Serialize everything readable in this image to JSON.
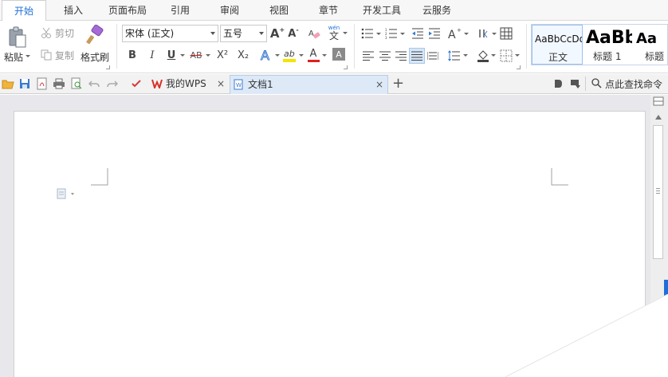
{
  "menu": {
    "tabs": [
      "开始",
      "插入",
      "页面布局",
      "引用",
      "审阅",
      "视图",
      "章节",
      "开发工具",
      "云服务"
    ],
    "active_index": 0
  },
  "ribbon": {
    "clipboard": {
      "paste": "粘贴",
      "cut": "剪切",
      "copy": "复制",
      "format_painter": "格式刷"
    },
    "font": {
      "family": "宋体 (正文)",
      "size": "五号",
      "bold": "B",
      "italic": "I",
      "underline": "U",
      "strike": "AB",
      "superscript": "X²",
      "subscript": "X₂",
      "font_color": "A",
      "char_shading": "A",
      "grow": "A",
      "shrink": "A",
      "pinyin": "wén"
    },
    "styles": [
      {
        "preview": "AaBbCcDd",
        "name": "正文"
      },
      {
        "preview": "AaBb",
        "name": "标题 1"
      },
      {
        "preview": "Aa",
        "name": "标题"
      }
    ],
    "colors": {
      "highlight": "#f5e400",
      "font_color": "#e02020",
      "accent": "#1e6fd9",
      "shading": "#888888"
    }
  },
  "tabbar": {
    "tabs": [
      {
        "label": "我的WPS",
        "active": false
      },
      {
        "label": "文档1",
        "active": true
      }
    ],
    "add": "+",
    "close": "×",
    "search": "点此查找命令"
  }
}
